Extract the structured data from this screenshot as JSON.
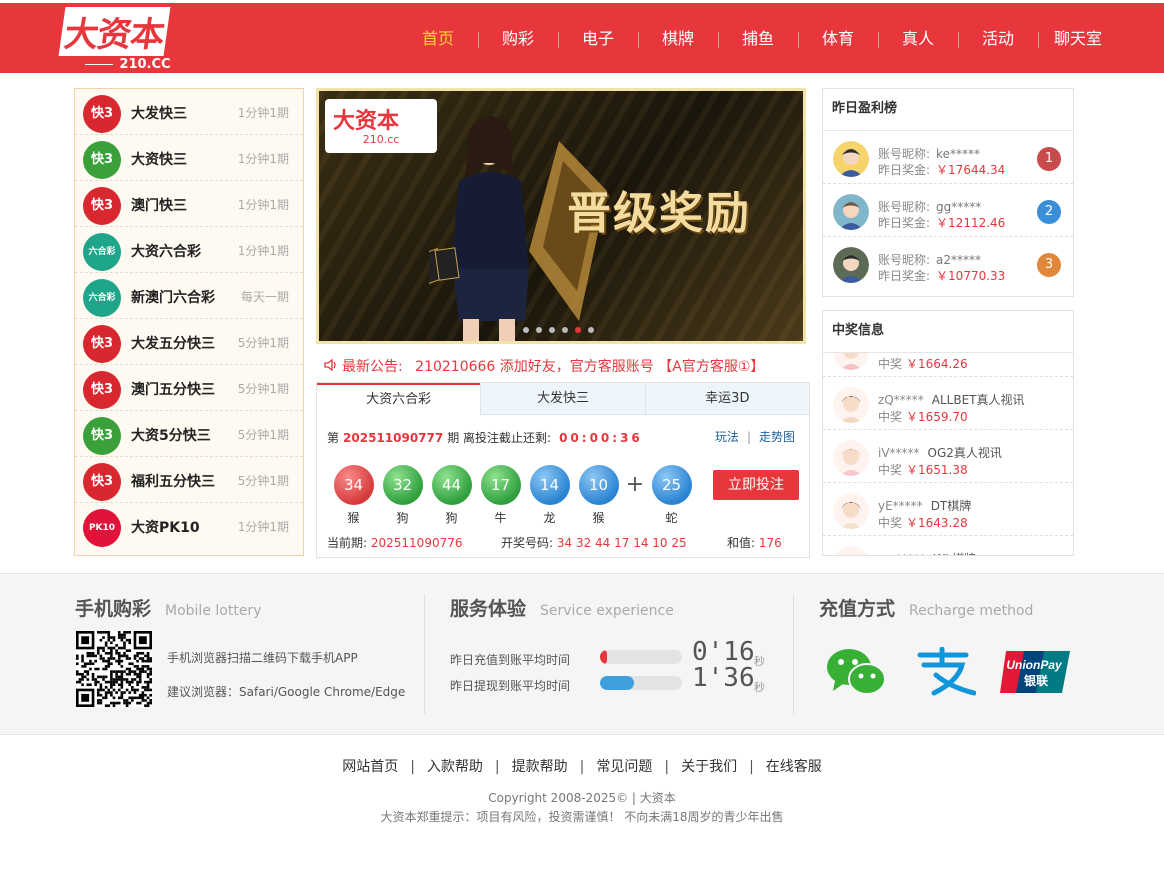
{
  "header": {
    "logo_main": "大资本",
    "logo_sub": "210.CC",
    "nav": [
      "首页",
      "购彩",
      "电子",
      "棋牌",
      "捕鱼",
      "体育",
      "真人",
      "活动",
      "聊天室"
    ],
    "active_nav": "首页"
  },
  "lottery_list": [
    {
      "name": "大发快三",
      "period": "1分钟1期",
      "icon": "kuai3-red-icon",
      "color": "#d8272e",
      "icon_text": "快3"
    },
    {
      "name": "大资快三",
      "period": "1分钟1期",
      "icon": "kuai3-green-icon",
      "color": "#3aa13a",
      "icon_text": "快3"
    },
    {
      "name": "澳门快三",
      "period": "1分钟1期",
      "icon": "kuai3-red-icon",
      "color": "#d8272e",
      "icon_text": "快3"
    },
    {
      "name": "大资六合彩",
      "period": "1分钟1期",
      "icon": "liuhecai-teal-icon",
      "color": "#1fa58a",
      "icon_text": "六合彩"
    },
    {
      "name": "新澳门六合彩",
      "period": "每天一期",
      "icon": "liuhecai-teal-icon",
      "color": "#1fa58a",
      "icon_text": "六合彩"
    },
    {
      "name": "大发五分快三",
      "period": "5分钟1期",
      "icon": "kuai3-red-icon",
      "color": "#d8272e",
      "icon_text": "快3"
    },
    {
      "name": "澳门五分快三",
      "period": "5分钟1期",
      "icon": "kuai3-red-icon",
      "color": "#d8272e",
      "icon_text": "快3"
    },
    {
      "name": "大资5分快三",
      "period": "5分钟1期",
      "icon": "kuai3-green-icon",
      "color": "#3aa13a",
      "icon_text": "快3"
    },
    {
      "name": "福利五分快三",
      "period": "5分钟1期",
      "icon": "kuai3-red-icon",
      "color": "#d8272e",
      "icon_text": "快3"
    },
    {
      "name": "大资PK10",
      "period": "1分钟1期",
      "icon": "pk10-icon",
      "color": "#e2133a",
      "icon_text": "PK10"
    }
  ],
  "banner": {
    "logo_main": "大资本",
    "logo_sub": "210.cc",
    "headline": "晋级奖励",
    "slides": 6,
    "active_slide": 5
  },
  "notice": {
    "label": "最新公告:",
    "text": "210210666 添加好友，官方客服账号 【A官方客服①】"
  },
  "lottery_panel": {
    "tabs": [
      "大资六合彩",
      "大发快三",
      "幸运3D"
    ],
    "active_tab": 0,
    "issue_prefix": "第",
    "issue_number": "202511090777",
    "issue_suffix": "期 离投注截止还剩:",
    "countdown": "00:00:36",
    "link_rules": "玩法",
    "link_trend": "走势图",
    "balls": [
      {
        "num": "34",
        "zodiac": "猴",
        "color": "red"
      },
      {
        "num": "32",
        "zodiac": "狗",
        "color": "green"
      },
      {
        "num": "44",
        "zodiac": "狗",
        "color": "green"
      },
      {
        "num": "17",
        "zodiac": "牛",
        "color": "green"
      },
      {
        "num": "14",
        "zodiac": "龙",
        "color": "blue"
      },
      {
        "num": "10",
        "zodiac": "猴",
        "color": "blue"
      }
    ],
    "plus": "+",
    "special_ball": {
      "num": "25",
      "zodiac": "蛇",
      "color": "blue"
    },
    "bet_button": "立即投注",
    "prev_label": "当前期:",
    "prev_issue": "202511090776",
    "draw_label": "开奖号码:",
    "draw_numbers": "34 32 44 17 14 10 25",
    "sum_label": "和值:",
    "sum_value": "176"
  },
  "ranking": {
    "title": "昨日盈利榜",
    "nick_label": "账号昵称:",
    "prize_label": "昨日奖金:",
    "rows": [
      {
        "nick": "ke*****",
        "prize": "￥17644.34",
        "rank": "1",
        "badge_color": "#c94a4a"
      },
      {
        "nick": "gg*****",
        "prize": "￥12112.46",
        "rank": "2",
        "badge_color": "#3b8fd8"
      },
      {
        "nick": "a2*****",
        "prize": "￥10770.33",
        "rank": "3",
        "badge_color": "#e0883a"
      }
    ]
  },
  "winners": {
    "title": "中奖信息",
    "won_label": "中奖",
    "rows": [
      {
        "user": "",
        "game": "",
        "amount": "￥1664.26"
      },
      {
        "user": "zQ*****",
        "game": "ALLBET真人视讯",
        "amount": "￥1659.70"
      },
      {
        "user": "iV*****",
        "game": "OG2真人视讯",
        "amount": "￥1651.38"
      },
      {
        "user": "yE*****",
        "game": "DT棋牌",
        "amount": "￥1643.28"
      },
      {
        "user": "uw*****",
        "game": "WL棋牌",
        "amount": ""
      }
    ]
  },
  "mobile": {
    "title": "手机购彩",
    "title_en": "Mobile lottery",
    "line1": "手机浏览器扫描二维码下载手机APP",
    "line2": "建议浏览器：Safari/Google Chrome/Edge"
  },
  "service": {
    "title": "服务体验",
    "title_en": "Service experience",
    "deposit_label": "昨日充值到账平均时间",
    "deposit_time": "0'16",
    "deposit_fill": 0.08,
    "withdraw_label": "昨日提现到账平均时间",
    "withdraw_time": "1'36",
    "withdraw_fill": 0.42,
    "unit": "秒"
  },
  "recharge": {
    "title": "充值方式",
    "title_en": "Recharge method",
    "methods": [
      "wechat-pay-icon",
      "alipay-icon",
      "unionpay-icon"
    ],
    "unionpay_text_en": "UnionPay",
    "unionpay_text_cn": "银联"
  },
  "footer": {
    "links": [
      "网站首页",
      "入款帮助",
      "提款帮助",
      "常见问题",
      "关于我们",
      "在线客服"
    ],
    "copyright": "Copyright 2008-2025© | 大资本",
    "warning": "大资本郑重提示：项目有风险，投资需谨慎！ 不向未满18周岁的青少年出售"
  }
}
